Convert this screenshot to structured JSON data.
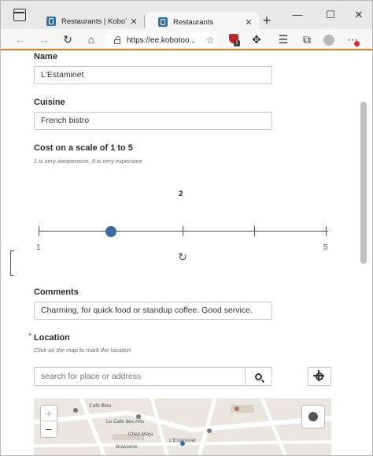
{
  "browser": {
    "tabs": [
      {
        "title": "Restaurants | KoboToolbox",
        "close": "✕"
      },
      {
        "title": "Restaurants",
        "close": "✕"
      }
    ],
    "new_tab": "+",
    "window_controls": {
      "minimize": "—",
      "maximize": "☐",
      "close": "✕"
    },
    "address": "https://ee.kobotoo...",
    "extension_badge": "1",
    "accent_color": "#e57a1f"
  },
  "form": {
    "name": {
      "label": "Name",
      "value": "L'Estaminet"
    },
    "cuisine": {
      "label": "Cuisine",
      "value": "French bistro"
    },
    "cost": {
      "label": "Cost on a scale of 1 to 5",
      "hint": "1 is very inexpensive, 5 is very expensive",
      "value": "2",
      "min_label": "1",
      "max_label": "5",
      "min": 1,
      "max": 5,
      "selected": 2
    },
    "comments": {
      "label": "Comments",
      "value": "Charming, for quick food or standup coffee.  Good service."
    },
    "location": {
      "required_mark": "*",
      "label": "Location",
      "hint": "Click on the map to mark the location",
      "search_placeholder": "search for place or address"
    }
  },
  "map": {
    "zoom_in": "+",
    "zoom_out": "−",
    "labels": [
      "Café Bleu",
      "Le Café des Arts",
      "Chez Maja",
      "L'Estaminet",
      "Brasserie"
    ]
  }
}
